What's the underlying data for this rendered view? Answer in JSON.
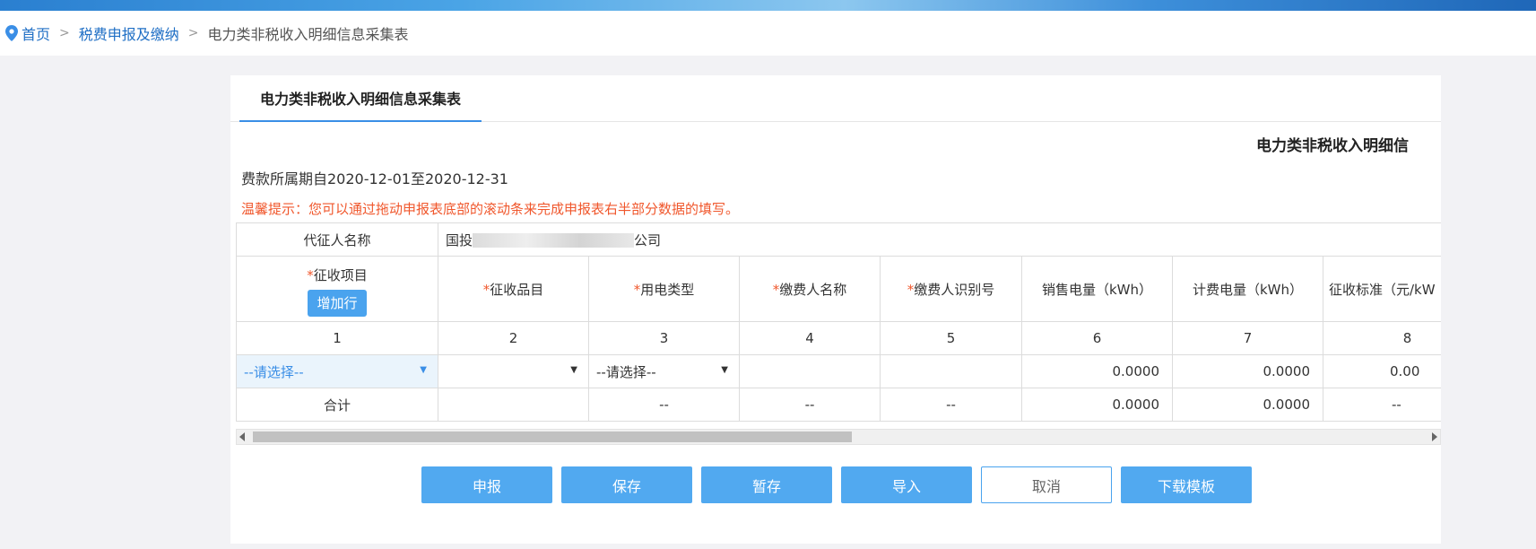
{
  "breadcrumb": {
    "home": "首页",
    "section": "税费申报及缴纳",
    "current": "电力类非税收入明细信息采集表"
  },
  "tab": {
    "label": "电力类非税收入明细信息采集表"
  },
  "form": {
    "title": "电力类非税收入明细信",
    "period": "费款所属期自2020-12-01至2020-12-31",
    "tip": "温馨提示：您可以通过拖动申报表底部的滚动条来完成申报表右半部分数据的填写。"
  },
  "agent": {
    "label": "代征人名称",
    "value_prefix": "国投",
    "value_suffix": "公司"
  },
  "table": {
    "headers": [
      {
        "required": true,
        "label": "征收项目"
      },
      {
        "required": true,
        "label": "征收品目"
      },
      {
        "required": true,
        "label": "用电类型"
      },
      {
        "required": true,
        "label": "缴费人名称"
      },
      {
        "required": true,
        "label": "缴费人识别号"
      },
      {
        "required": false,
        "label": "销售电量（kWh）"
      },
      {
        "required": false,
        "label": "计费电量（kWh）"
      },
      {
        "required": false,
        "label": "征收标准（元/kW"
      }
    ],
    "required_mark": "*",
    "add_row_label": "增加行",
    "col_numbers": [
      "1",
      "2",
      "3",
      "4",
      "5",
      "6",
      "7",
      "8"
    ],
    "data_row": {
      "item_select": "--请选择--",
      "category_select": "",
      "elec_type_select": "--请选择--",
      "payer_name": "",
      "payer_id": "",
      "sales_kwh": "0.0000",
      "billed_kwh": "0.0000",
      "standard": "0.00"
    },
    "total_row": {
      "label": "合计",
      "category": "",
      "elec_type": "--",
      "payer_name": "--",
      "payer_id": "--",
      "sales_kwh": "0.0000",
      "billed_kwh": "0.0000",
      "standard": "--"
    }
  },
  "actions": {
    "declare": "申报",
    "save": "保存",
    "temp_save": "暂存",
    "import": "导入",
    "cancel": "取消",
    "download_template": "下载模板"
  },
  "colors": {
    "accent": "#3a8ee6",
    "button": "#51a9f0",
    "warning": "#f0572c"
  }
}
